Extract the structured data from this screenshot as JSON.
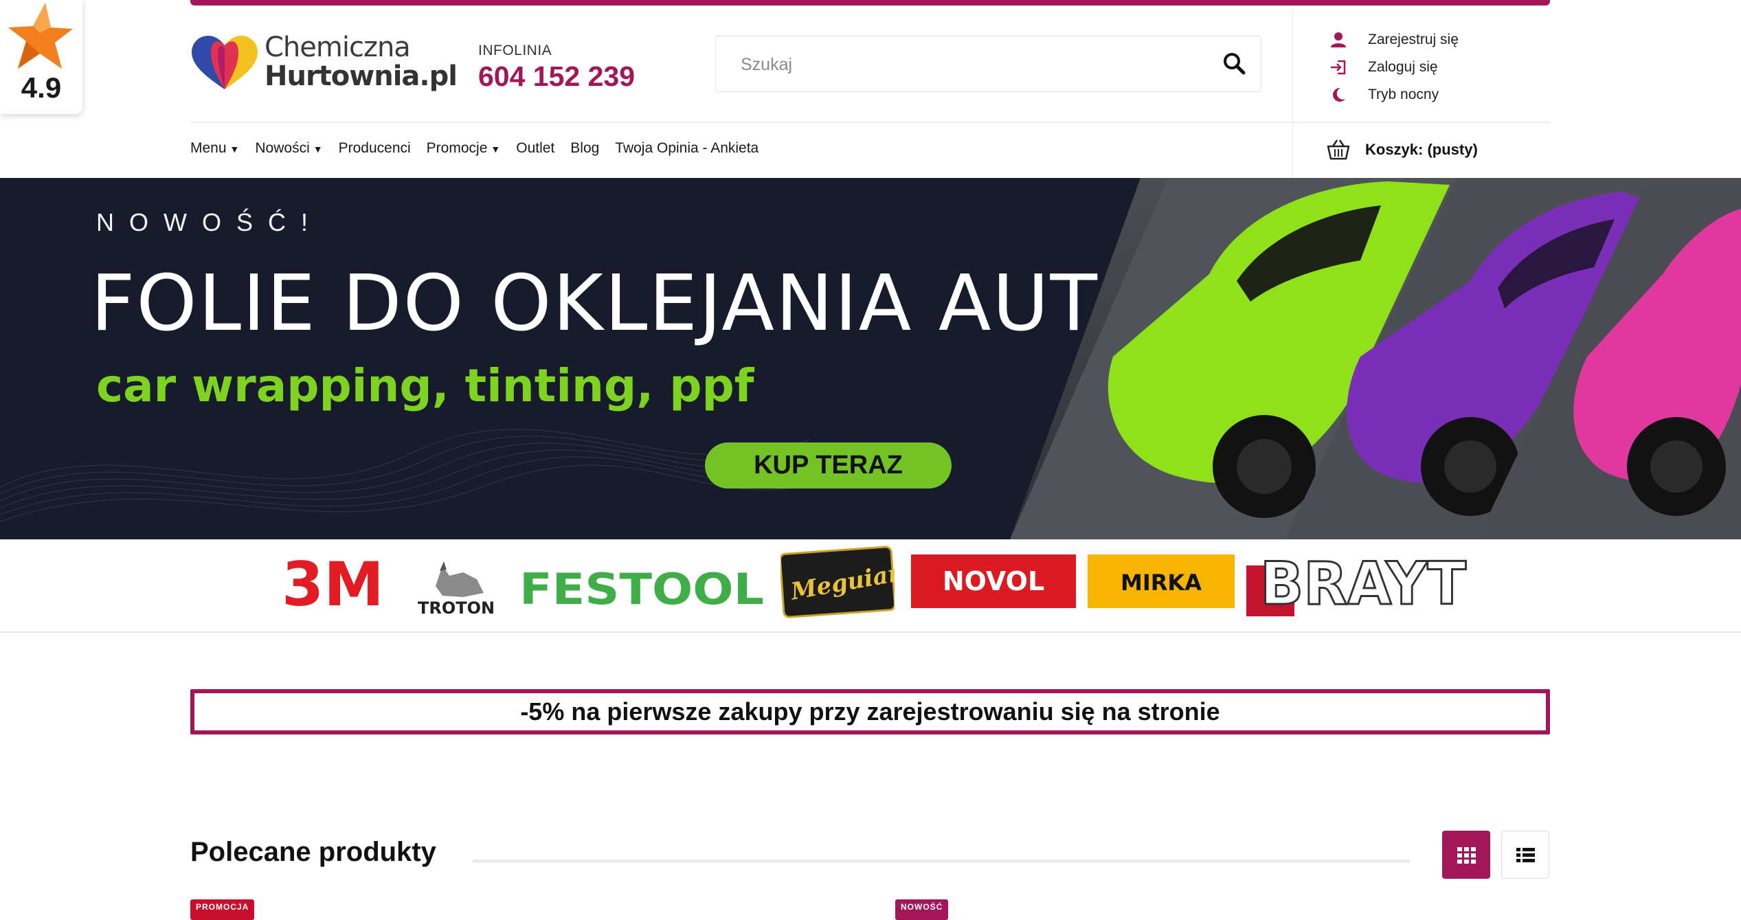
{
  "rating": {
    "score": "4.9"
  },
  "brand": {
    "logo_line1": "Chemiczna",
    "logo_line2": "Hurtownia.pl",
    "accent_color": "#a3175a"
  },
  "infolinia": {
    "label": "INFOLINIA",
    "number": "604 152 239"
  },
  "search": {
    "placeholder": "Szukaj"
  },
  "user_links": {
    "register": "Zarejestruj się",
    "login": "Zaloguj się",
    "night_mode": "Tryb nocny"
  },
  "nav": {
    "menu": "Menu",
    "nowosci": "Nowości",
    "producenci": "Producenci",
    "promocje": "Promocje",
    "outlet": "Outlet",
    "blog": "Blog",
    "opinia": "Twoja Opinia - Ankieta"
  },
  "cart": {
    "label": "Koszyk: (pusty)"
  },
  "hero": {
    "kicker": "NOWOŚĆ!",
    "title": "FOLIE DO OKLEJANIA AUT",
    "subtitle": "car wrapping, tinting, ppf",
    "cta": "KUP TERAZ",
    "subtitle_color": "#7ed321",
    "cta_color": "#74c324"
  },
  "brands": {
    "b3m": "3M",
    "troton": "TROTON",
    "festool": "FESTOOL",
    "meguiars": "Meguiar's",
    "novol": "NOVOL",
    "mirka": "MIRKA",
    "brayt": "BRAYT"
  },
  "promo": {
    "text": "-5% na pierwsze zakupy przy zarejestrowaniu się na stronie"
  },
  "featured": {
    "title": "Polecane produkty",
    "badge_promo": "PROMOCJA",
    "badge_new": "NOWOŚĆ"
  }
}
